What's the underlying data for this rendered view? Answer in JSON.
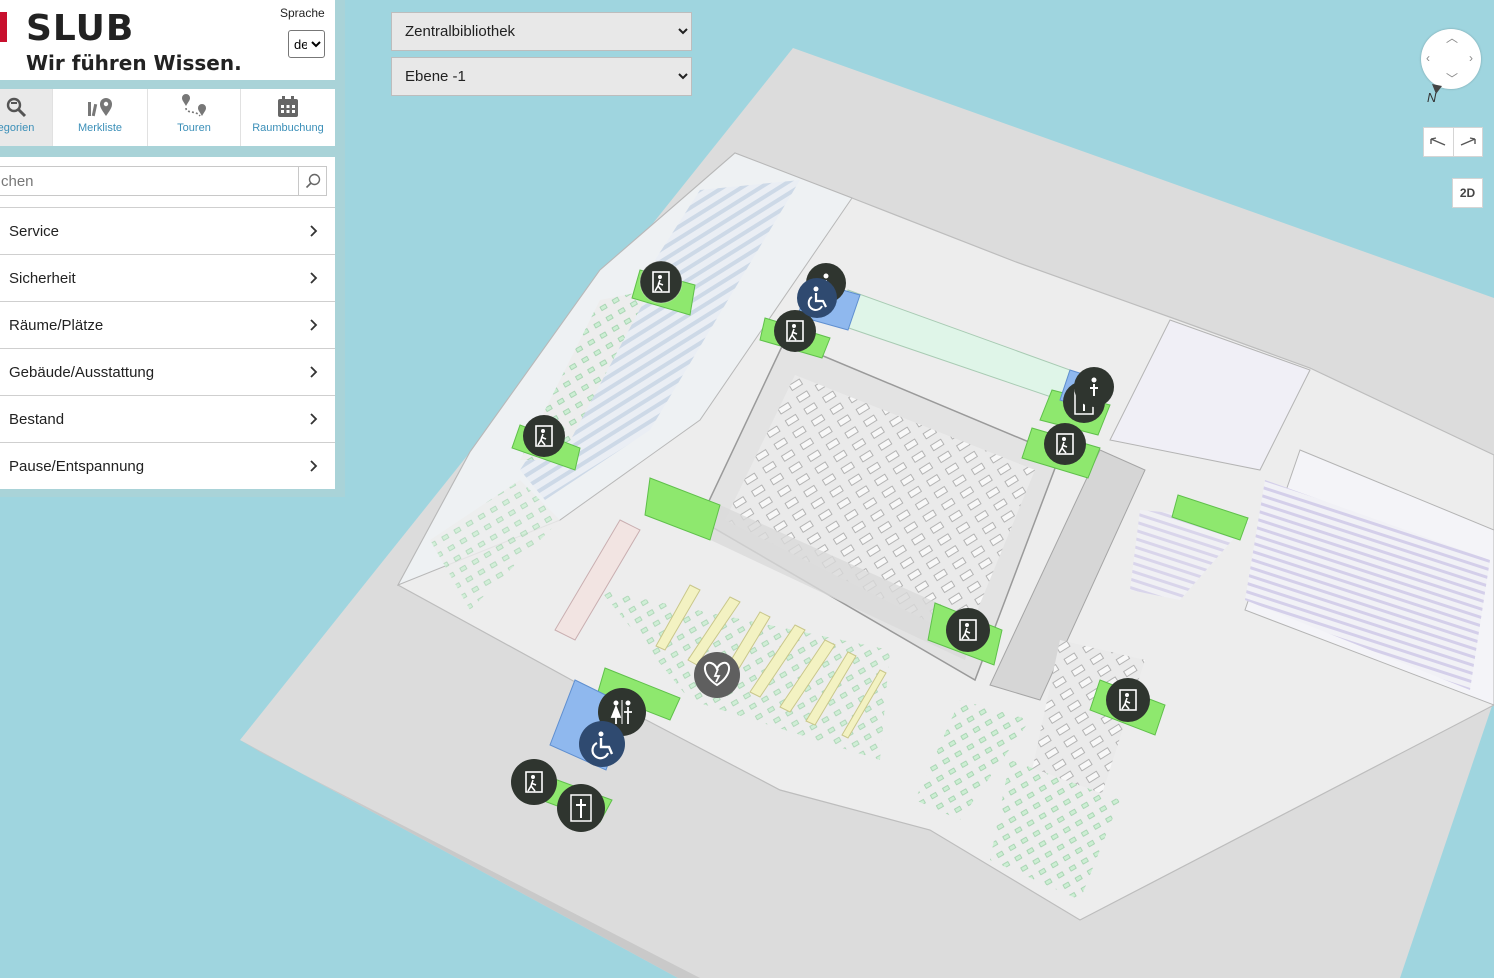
{
  "brand": {
    "name": "SLUB",
    "tagline": "Wir führen Wissen."
  },
  "language": {
    "label": "Sprache",
    "selected": "de"
  },
  "nav_tabs": [
    {
      "label": "egorien",
      "icon": "categories-icon",
      "active": true
    },
    {
      "label": "Merkliste",
      "icon": "bookmark-list-icon"
    },
    {
      "label": "Touren",
      "icon": "tours-icon"
    },
    {
      "label": "Raumbuchung",
      "icon": "calendar-icon"
    }
  ],
  "search": {
    "placeholder": "chen"
  },
  "categories": [
    {
      "label": "Service"
    },
    {
      "label": "Sicherheit"
    },
    {
      "label": "Räume/Plätze"
    },
    {
      "label": "Gebäude/Ausstattung"
    },
    {
      "label": "Bestand"
    },
    {
      "label": "Pause/Entspannung"
    }
  ],
  "building_select": {
    "selected": "Zentralbibliothek"
  },
  "floor_select": {
    "selected": "Ebene -1"
  },
  "map_controls": {
    "north_label": "N",
    "view_toggle": "2D"
  },
  "colors": {
    "water": "#9fd5df",
    "plot": "#dcdcdc",
    "floor": "#ececec",
    "highlight_green": "#8ee86e",
    "highlight_blue": "#8fb8ee",
    "poi_bg": "#2f352f",
    "link": "#3b8fb8"
  },
  "map_pois": [
    {
      "icon": "emergency-exit-icon"
    },
    {
      "icon": "emergency-exit-icon"
    },
    {
      "icon": "emergency-exit-icon"
    },
    {
      "icon": "emergency-exit-icon"
    },
    {
      "icon": "emergency-exit-icon"
    },
    {
      "icon": "emergency-exit-icon"
    },
    {
      "icon": "emergency-exit-icon"
    },
    {
      "icon": "emergency-exit-icon"
    },
    {
      "icon": "elevator-icon"
    },
    {
      "icon": "elevator-icon"
    },
    {
      "icon": "wheelchair-icon"
    },
    {
      "icon": "wheelchair-icon"
    },
    {
      "icon": "restroom-icon"
    },
    {
      "icon": "restroom-icon"
    },
    {
      "icon": "defibrillator-icon"
    }
  ]
}
